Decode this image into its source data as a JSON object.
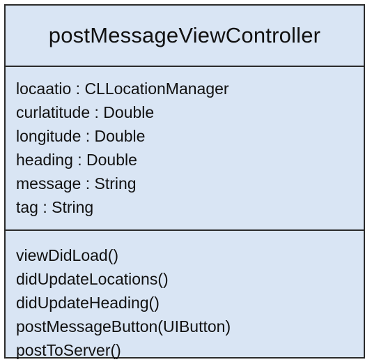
{
  "class_box": {
    "name": "postMessageViewController",
    "attributes": [
      "locaatio : CLLocationManager",
      "curlatitude : Double",
      "longitude : Double",
      "heading : Double",
      "message : String",
      "tag : String"
    ],
    "methods": [
      "viewDidLoad()",
      "didUpdateLocations()",
      "didUpdateHeading()",
      "postMessageButton(UIButton)",
      "postToServer()"
    ],
    "colors": {
      "fill": "#d9e5f4",
      "border": "#2b2b2b",
      "text": "#111111"
    }
  }
}
